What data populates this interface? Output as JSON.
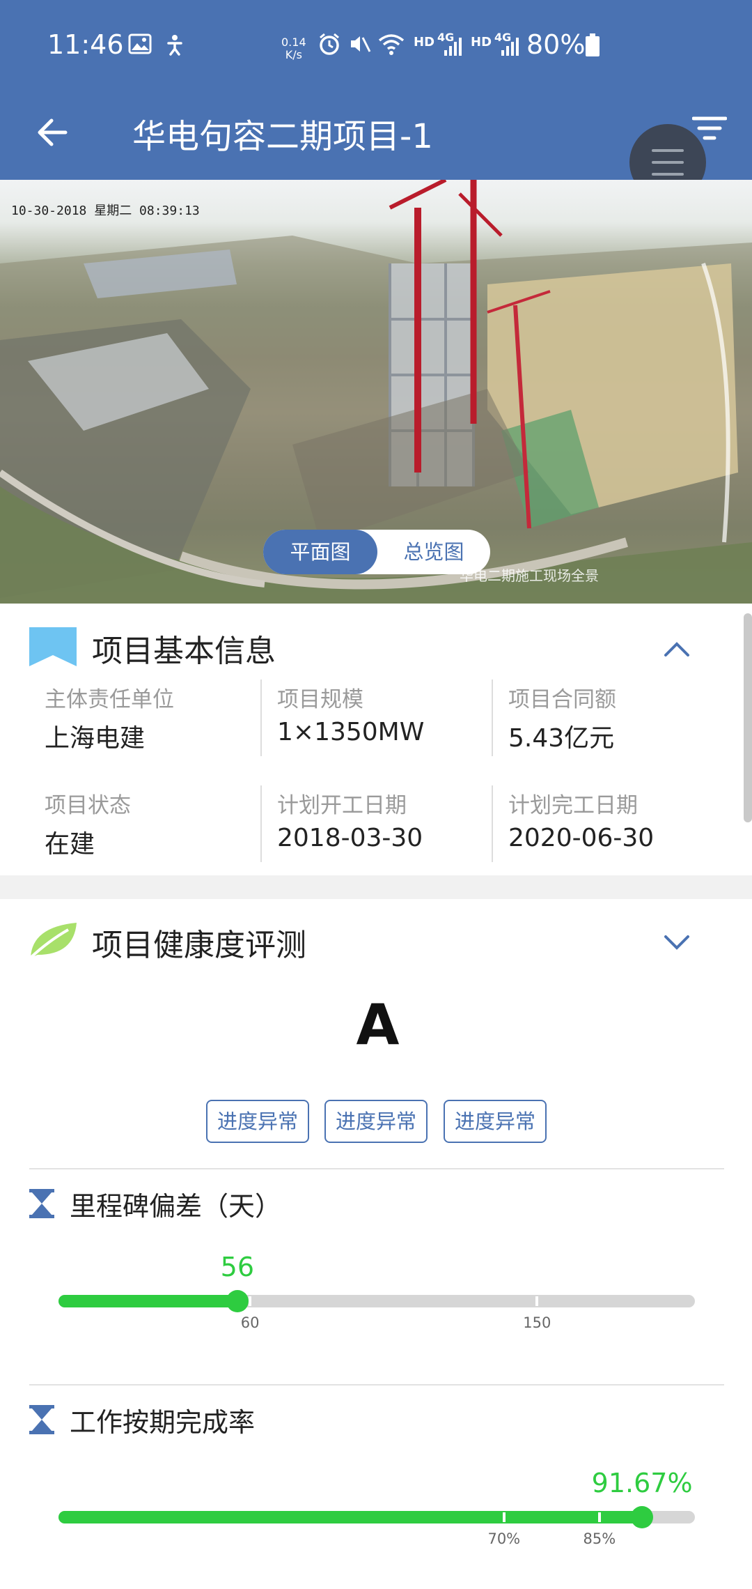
{
  "status_bar": {
    "time": "11:46",
    "network_speed_value": "0.14",
    "network_speed_unit": "K/s",
    "hd1": "HD",
    "net1": "4G",
    "hd2": "HD",
    "net2": "4G",
    "battery": "80%"
  },
  "header": {
    "title": "华电句容二期项目-1"
  },
  "photo": {
    "timestamp": "10-30-2018 星期二 08:39:13",
    "watermark": "华电二期施工现场全景",
    "view_toggle": {
      "plan": "平面图",
      "overview": "总览图",
      "selected": "plan"
    }
  },
  "basic_info": {
    "title": "项目基本信息",
    "fields": [
      {
        "label": "主体责任单位",
        "value": "上海电建"
      },
      {
        "label": "项目规模",
        "value": "1×1350MW"
      },
      {
        "label": "项目合同额",
        "value": "5.43亿元"
      },
      {
        "label": "项目状态",
        "value": "在建"
      },
      {
        "label": "计划开工日期",
        "value": "2018-03-30"
      },
      {
        "label": "计划完工日期",
        "value": "2020-06-30"
      }
    ]
  },
  "health": {
    "title": "项目健康度评测",
    "grade": "A",
    "tags": [
      "进度异常",
      "进度异常",
      "进度异常"
    ],
    "metrics": [
      {
        "title": "里程碑偏差（天）",
        "value_label": "56",
        "value_fraction": 0.281,
        "ticks": [
          {
            "label": "60",
            "fraction": 0.301
          },
          {
            "label": "150",
            "fraction": 0.752
          }
        ]
      },
      {
        "title": "工作按期完成率",
        "value_label": "91.67%",
        "value_fraction": 0.917,
        "ticks": [
          {
            "label": "70%",
            "fraction": 0.7
          },
          {
            "label": "85%",
            "fraction": 0.85
          }
        ]
      }
    ]
  },
  "colors": {
    "header_blue": "#4a72b2",
    "progress_green": "#2ecc40",
    "track_gray": "#d6d6d6",
    "info_icon_blue": "#6ec4f2",
    "leaf_green": "#a8e06a"
  }
}
